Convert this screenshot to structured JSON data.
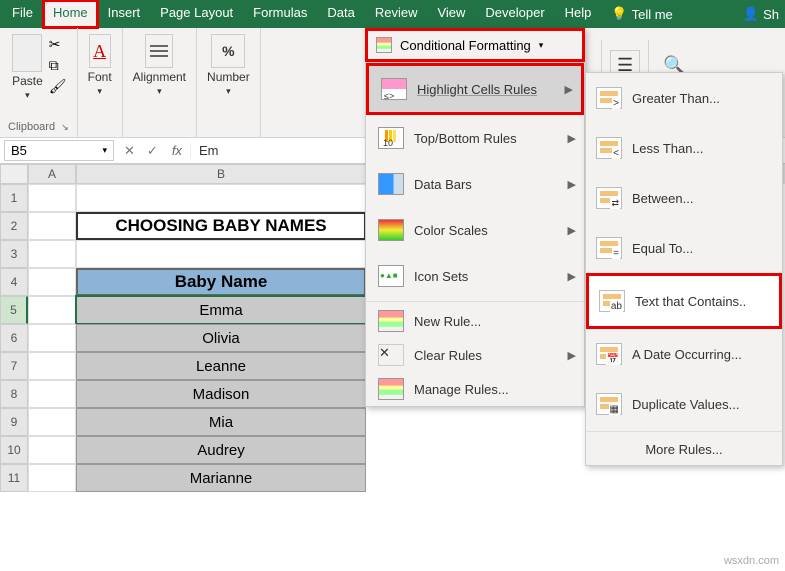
{
  "tabs": {
    "file": "File",
    "home": "Home",
    "insert": "Insert",
    "page_layout": "Page Layout",
    "formulas": "Formulas",
    "data": "Data",
    "review": "Review",
    "view": "View",
    "developer": "Developer",
    "help": "Help",
    "tell_me": "Tell me",
    "share": "Sh"
  },
  "ribbon": {
    "paste": "Paste",
    "clipboard": "Clipboard",
    "font": "Font",
    "alignment": "Alignment",
    "number": "Number",
    "percent": "%",
    "cond_fmt": "Conditional Formatting"
  },
  "cf_menu": {
    "highlight": "Highlight Cells Rules",
    "topbottom": "Top/Bottom Rules",
    "databars": "Data Bars",
    "colorscales": "Color Scales",
    "iconsets": "Icon Sets",
    "newrule": "New Rule...",
    "clear": "Clear Rules",
    "manage": "Manage Rules..."
  },
  "hcr_menu": {
    "gt": "Greater Than...",
    "lt": "Less Than...",
    "between": "Between...",
    "equal": "Equal To...",
    "text": "Text that Contains..",
    "date": "A Date Occurring...",
    "dup": "Duplicate Values...",
    "more": "More Rules..."
  },
  "formula_bar": {
    "namebox": "B5",
    "fx": "fx",
    "value_prefix": "Em"
  },
  "columns": {
    "a": "A",
    "b": "B"
  },
  "rows": [
    "1",
    "2",
    "3",
    "4",
    "5",
    "6",
    "7",
    "8",
    "9",
    "10",
    "11"
  ],
  "sheet": {
    "title": "CHOOSING BABY NAMES",
    "header": "Baby Name",
    "names": [
      "Emma",
      "Olivia",
      "Leanne",
      "Madison",
      "Mia",
      "Audrey",
      "Marianne"
    ]
  },
  "watermark": "wsxdn.com"
}
